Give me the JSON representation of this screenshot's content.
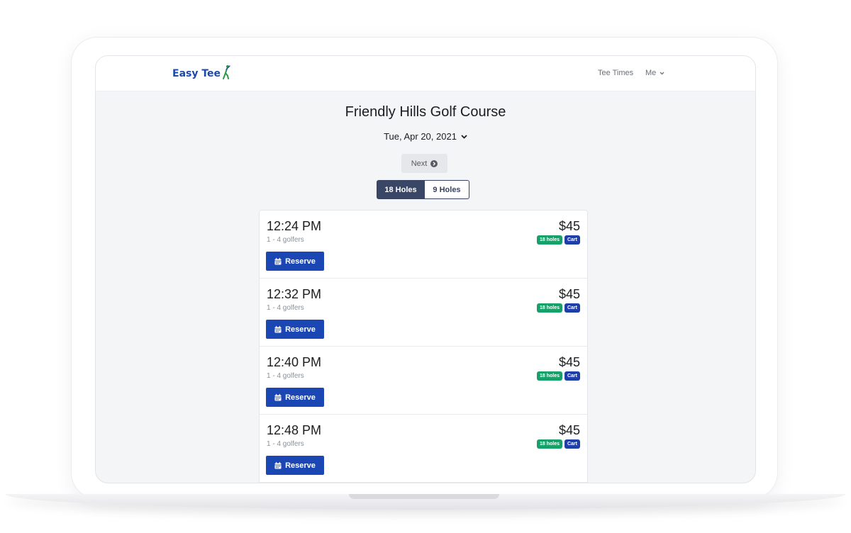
{
  "header": {
    "brand": "Easy Tee",
    "nav": {
      "tee_times": "Tee Times",
      "me": "Me"
    }
  },
  "main": {
    "course_title": "Friendly Hills Golf Course",
    "date": "Tue, Apr 20, 2021",
    "next_label": "Next",
    "holes_toggle": {
      "option_18": "18 Holes",
      "option_9": "9 Holes",
      "selected": "18 Holes"
    },
    "tee_times": [
      {
        "time": "12:24 PM",
        "golfers": "1 - 4 golfers",
        "price": "$45",
        "badge_holes": "18 holes",
        "badge_cart": "Cart",
        "reserve_label": "Reserve"
      },
      {
        "time": "12:32 PM",
        "golfers": "1 - 4 golfers",
        "price": "$45",
        "badge_holes": "18 holes",
        "badge_cart": "Cart",
        "reserve_label": "Reserve"
      },
      {
        "time": "12:40 PM",
        "golfers": "1 - 4 golfers",
        "price": "$45",
        "badge_holes": "18 holes",
        "badge_cart": "Cart",
        "reserve_label": "Reserve"
      },
      {
        "time": "12:48 PM",
        "golfers": "1 - 4 golfers",
        "price": "$45",
        "badge_holes": "18 holes",
        "badge_cart": "Cart",
        "reserve_label": "Reserve"
      }
    ]
  },
  "colors": {
    "brand_blue": "#1d49a7",
    "golfer_green": "#2a9a4a",
    "primary_button": "#1b47b5",
    "toggle_active": "#3a4666",
    "badge_green": "#18a06a",
    "badge_blue": "#1d3fa7"
  },
  "icons": {
    "logo": "golfer-icon",
    "me_menu": "chevron-down-icon",
    "date_menu": "chevron-down-icon",
    "next": "arrow-circle-right-icon",
    "reserve": "calendar-icon"
  }
}
